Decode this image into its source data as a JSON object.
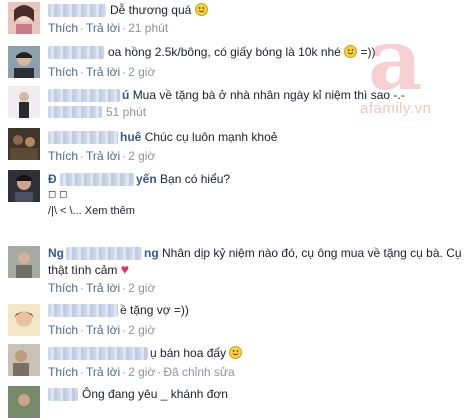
{
  "watermark": {
    "text": "afamily.vn"
  },
  "actions": {
    "like": "Thích",
    "reply": "Trả lời",
    "separator": "·",
    "edit": "Đã chỉnh sửa"
  },
  "comments": [
    {
      "name_visible": "",
      "text": "Dễ thương quá",
      "emoji": true,
      "time": "21 phút",
      "avatar_color": "#d9a9a4"
    },
    {
      "name_visible": "",
      "text": "oa hồng 2.5k/bông, có giấy bóng là 10k nhé",
      "emoji": true,
      "text_suffix": " =))",
      "time": "2 giờ",
      "avatar_color": "#5f6a72"
    },
    {
      "name_visible": "ú",
      "text": "Mua về tặng bà ở nhà nhân ngày kỉ niệm thì sao -.-",
      "time": "51 phút",
      "avatar_color": "#e6e3e6"
    },
    {
      "name_visible": "huê",
      "text": "Chúc cụ luôn mạnh khoẻ",
      "time": "2 giờ",
      "avatar_color": "#4e4438"
    },
    {
      "name_prefix": "Đ",
      "name_visible": "yến",
      "text": "Bạn có hiểu?",
      "line2": "◻ ◻",
      "line3": "/|\\ <  \\... Xem thêm",
      "time": "",
      "avatar_color": "#3c3c44"
    },
    {
      "name_prefix": "Ng",
      "name_visible": "ng",
      "text": "Nhân dịp kỷ niệm nào đó, cụ ông mua về tặng cụ bà. Cụ",
      "line2": "thật tình cảm",
      "heart": "♥",
      "time": "2 giờ",
      "avatar_color": "#8b8f84"
    },
    {
      "name_visible": "",
      "text": "ề tặng vợ =))",
      "time": "2 giờ",
      "avatar_color": "#e8d6a4"
    },
    {
      "name_visible": "",
      "text": "bán hoa đấy",
      "text_prefix": "ụ",
      "emoji": true,
      "time": "2 giờ",
      "edited": true,
      "avatar_color": "#7a7368"
    },
    {
      "name_visible": "",
      "text": "Ông đang yêu _ khánh đơn",
      "time": "",
      "avatar_color": "#6e7f62"
    }
  ]
}
